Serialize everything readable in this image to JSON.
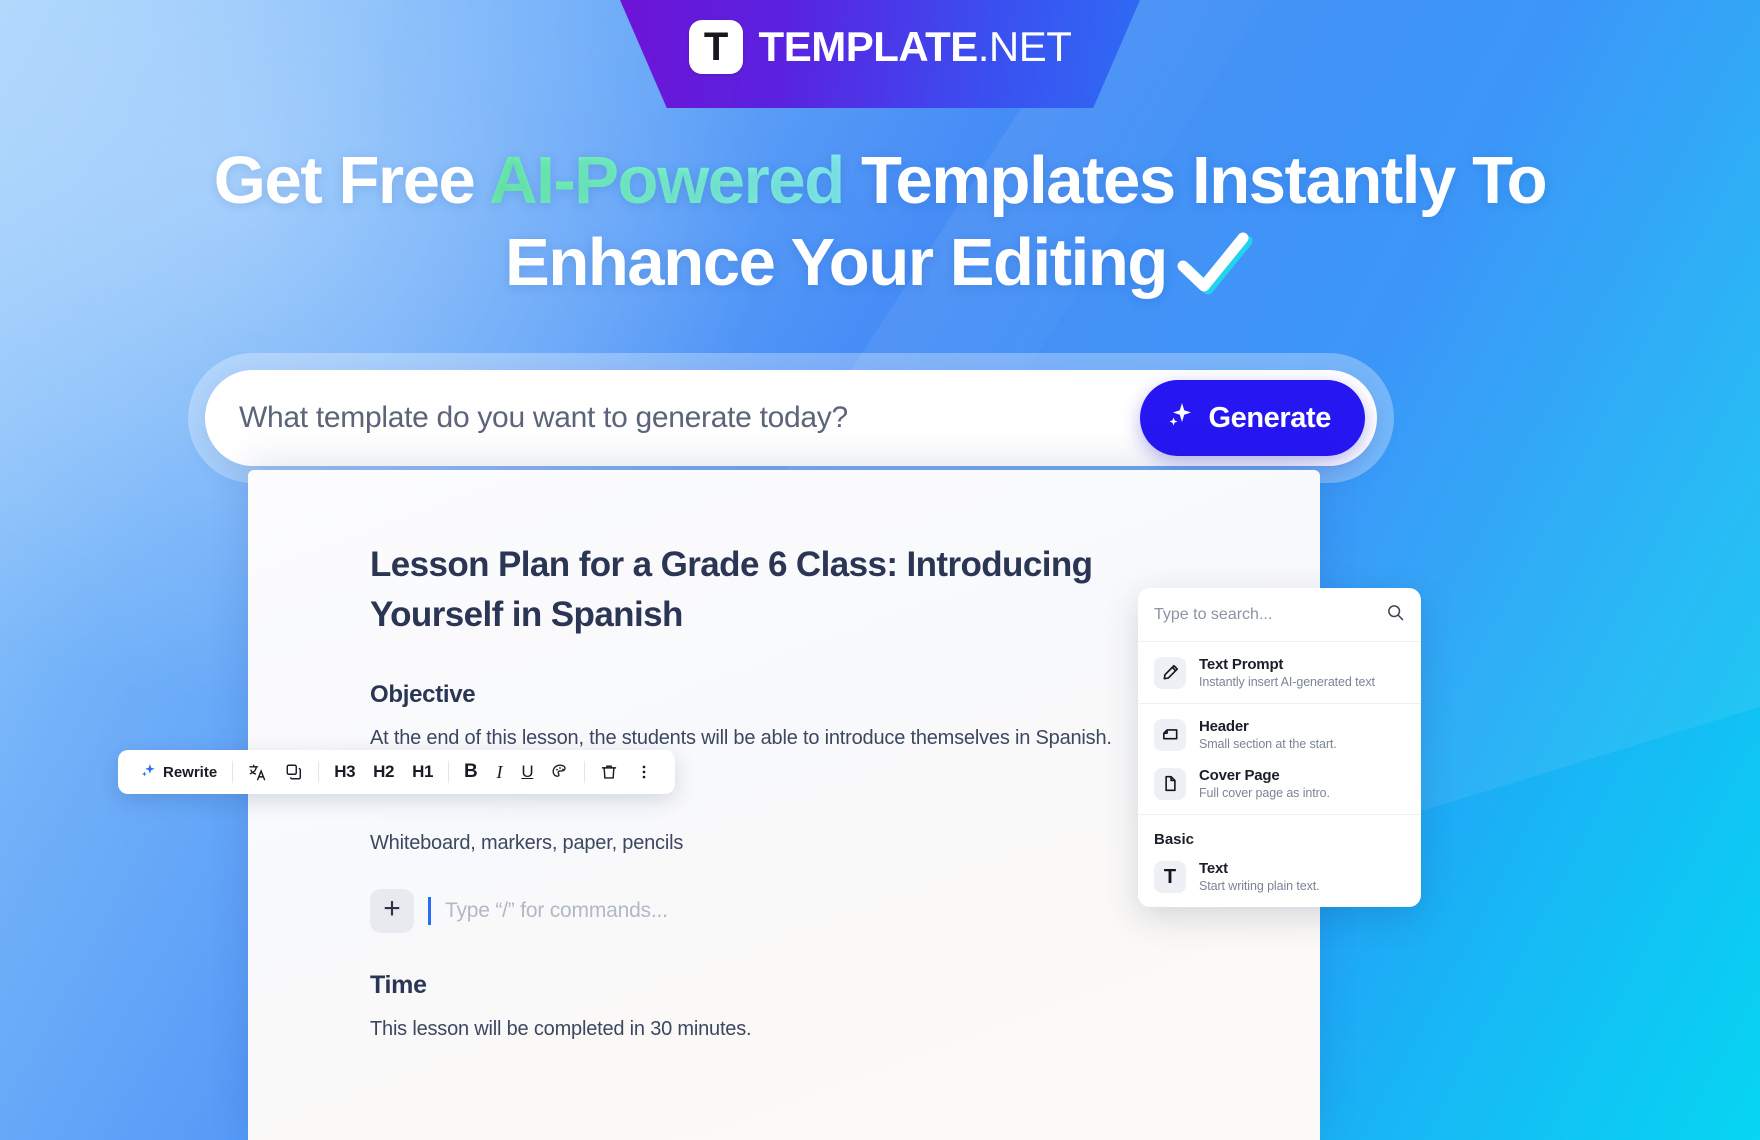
{
  "banner": {
    "logo_letter": "T",
    "brand_bold": "TEMPLATE",
    "brand_light": ".NET",
    "gradient_from": "#6d14d6",
    "gradient_to": "#2f6bf4"
  },
  "headline": {
    "line1_a": "Get Free ",
    "line1_accent": "AI-Powered",
    "line1_b": " Templates Instantly To",
    "line2": "Enhance Your Editing",
    "accent_gradient_from": "#6ef5a8",
    "accent_gradient_to": "#86f2ef",
    "check_icon": "check-mark-icon",
    "check_shadow_color": "#22d3ee"
  },
  "search": {
    "placeholder": "What template do you want to generate today?",
    "value": "",
    "generate_label": "Generate",
    "generate_icon": "sparkle-icon",
    "generate_bg": "#2616f2"
  },
  "document": {
    "title": "Lesson Plan for a Grade 6 Class: Introducing Yourself in Spanish",
    "sections": [
      {
        "heading": "Objective",
        "body": "At the end of this lesson, the students will be able to introduce themselves in Spanish."
      },
      {
        "heading": "Time",
        "body": "This lesson will be completed in 30 minutes."
      }
    ],
    "materials_text": "Whiteboard, markers, paper, pencils",
    "command_placeholder": "Type “/” for commands...",
    "add_block_icon": "plus-icon",
    "caret_color": "#2b6cf5"
  },
  "toolbar": {
    "rewrite_label": "Rewrite",
    "rewrite_icon": "sparkle-icon",
    "items": [
      {
        "name": "translate-icon",
        "label": "文A",
        "type": "icon"
      },
      {
        "name": "copy-icon",
        "label": "❐",
        "type": "icon"
      },
      {
        "name": "heading-3-button",
        "label": "H3",
        "type": "text"
      },
      {
        "name": "heading-2-button",
        "label": "H2",
        "type": "text"
      },
      {
        "name": "heading-1-button",
        "label": "H1",
        "type": "text"
      },
      {
        "name": "bold-button",
        "label": "B",
        "type": "text"
      },
      {
        "name": "italic-button",
        "label": "I",
        "type": "text"
      },
      {
        "name": "underline-button",
        "label": "U",
        "type": "text"
      },
      {
        "name": "palette-icon",
        "label": "◐",
        "type": "icon"
      },
      {
        "name": "trash-icon",
        "label": "Ὕ1",
        "type": "icon"
      },
      {
        "name": "more-options-icon",
        "label": "⋮",
        "type": "icon"
      }
    ]
  },
  "command_menu": {
    "search_placeholder": "Type to search...",
    "search_icon": "search-icon",
    "groups": [
      {
        "label": "",
        "items": [
          {
            "title": "Text Prompt",
            "desc": "Instantly insert AI-generated text",
            "icon": "pencil-icon"
          },
          {
            "title": "Header",
            "desc": "Small section at the start.",
            "icon": "header-block-icon"
          },
          {
            "title": "Cover Page",
            "desc": "Full cover page as intro.",
            "icon": "page-icon"
          }
        ]
      },
      {
        "label": "Basic",
        "items": [
          {
            "title": "Text",
            "desc": "Start writing plain text.",
            "icon": "text-t-icon"
          }
        ]
      }
    ]
  }
}
